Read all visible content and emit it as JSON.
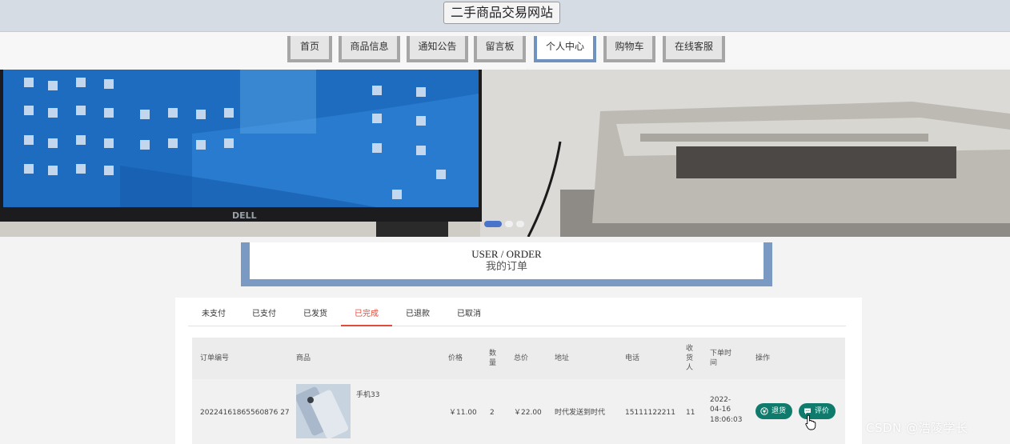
{
  "site": {
    "title": "二手商品交易网站"
  },
  "nav": {
    "items": [
      {
        "label": "首页"
      },
      {
        "label": "商品信息"
      },
      {
        "label": "通知公告"
      },
      {
        "label": "留言板"
      },
      {
        "label": "个人中心",
        "active": true
      },
      {
        "label": "购物车"
      },
      {
        "label": "在线客服"
      }
    ],
    "active_color": "#6f92c0"
  },
  "banner": {
    "slides": 3,
    "active_slide": 1,
    "monitor_brand": "DELL"
  },
  "section": {
    "title_en": "USER / ORDER",
    "title_cn": "我的订单"
  },
  "order_tabs": {
    "items": [
      "未支付",
      "已支付",
      "已发货",
      "已完成",
      "已退款",
      "已取消"
    ],
    "active": "已完成",
    "active_color": "#e14b3b"
  },
  "table": {
    "headers": {
      "order_no": "订单编号",
      "product": "商品",
      "price": "价格",
      "qty": "数量",
      "total": "总价",
      "address": "地址",
      "phone": "电话",
      "receiver": "收货人",
      "time": "下单时间",
      "actions": "操作"
    },
    "rows": [
      {
        "order_no": "20224161865560876 27",
        "product_name": "手机33",
        "price": "￥11.00",
        "qty": "2",
        "total": "￥22.00",
        "address": "时代发送到时代",
        "phone": "15111122211",
        "receiver": "11",
        "date": "2022-04-16",
        "time": "18:06:03",
        "refund_label": "退货",
        "review_label": "评价"
      }
    ],
    "button_color": "#0f7b6c"
  },
  "watermark": "CSDN @浩陵学长"
}
